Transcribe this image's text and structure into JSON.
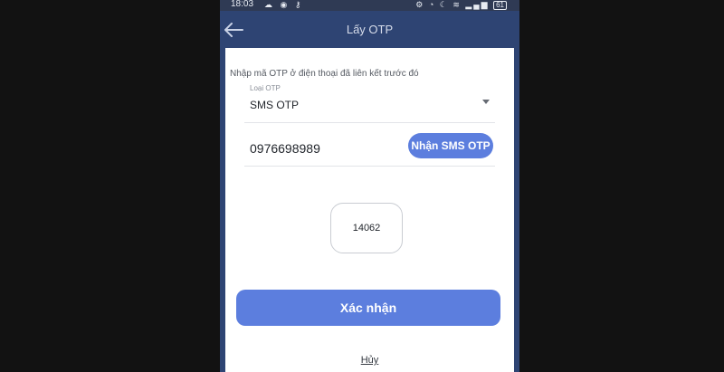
{
  "status_bar": {
    "time": "18:03",
    "battery": "61"
  },
  "app_bar": {
    "title": "Lấy OTP"
  },
  "form": {
    "hint": "Nhập mã OTP ở điện thoại đã liên kết trước đó",
    "otp_type": {
      "label": "Loại OTP",
      "selected": "SMS OTP"
    },
    "phone_number": "0976698989",
    "request_otp_button": "Nhận SMS OTP",
    "otp_code": "14062",
    "confirm_button": "Xác nhận",
    "cancel_link": "Hủy"
  },
  "colors": {
    "app_bar": "#2e4473",
    "primary_button": "#5c7ede"
  }
}
